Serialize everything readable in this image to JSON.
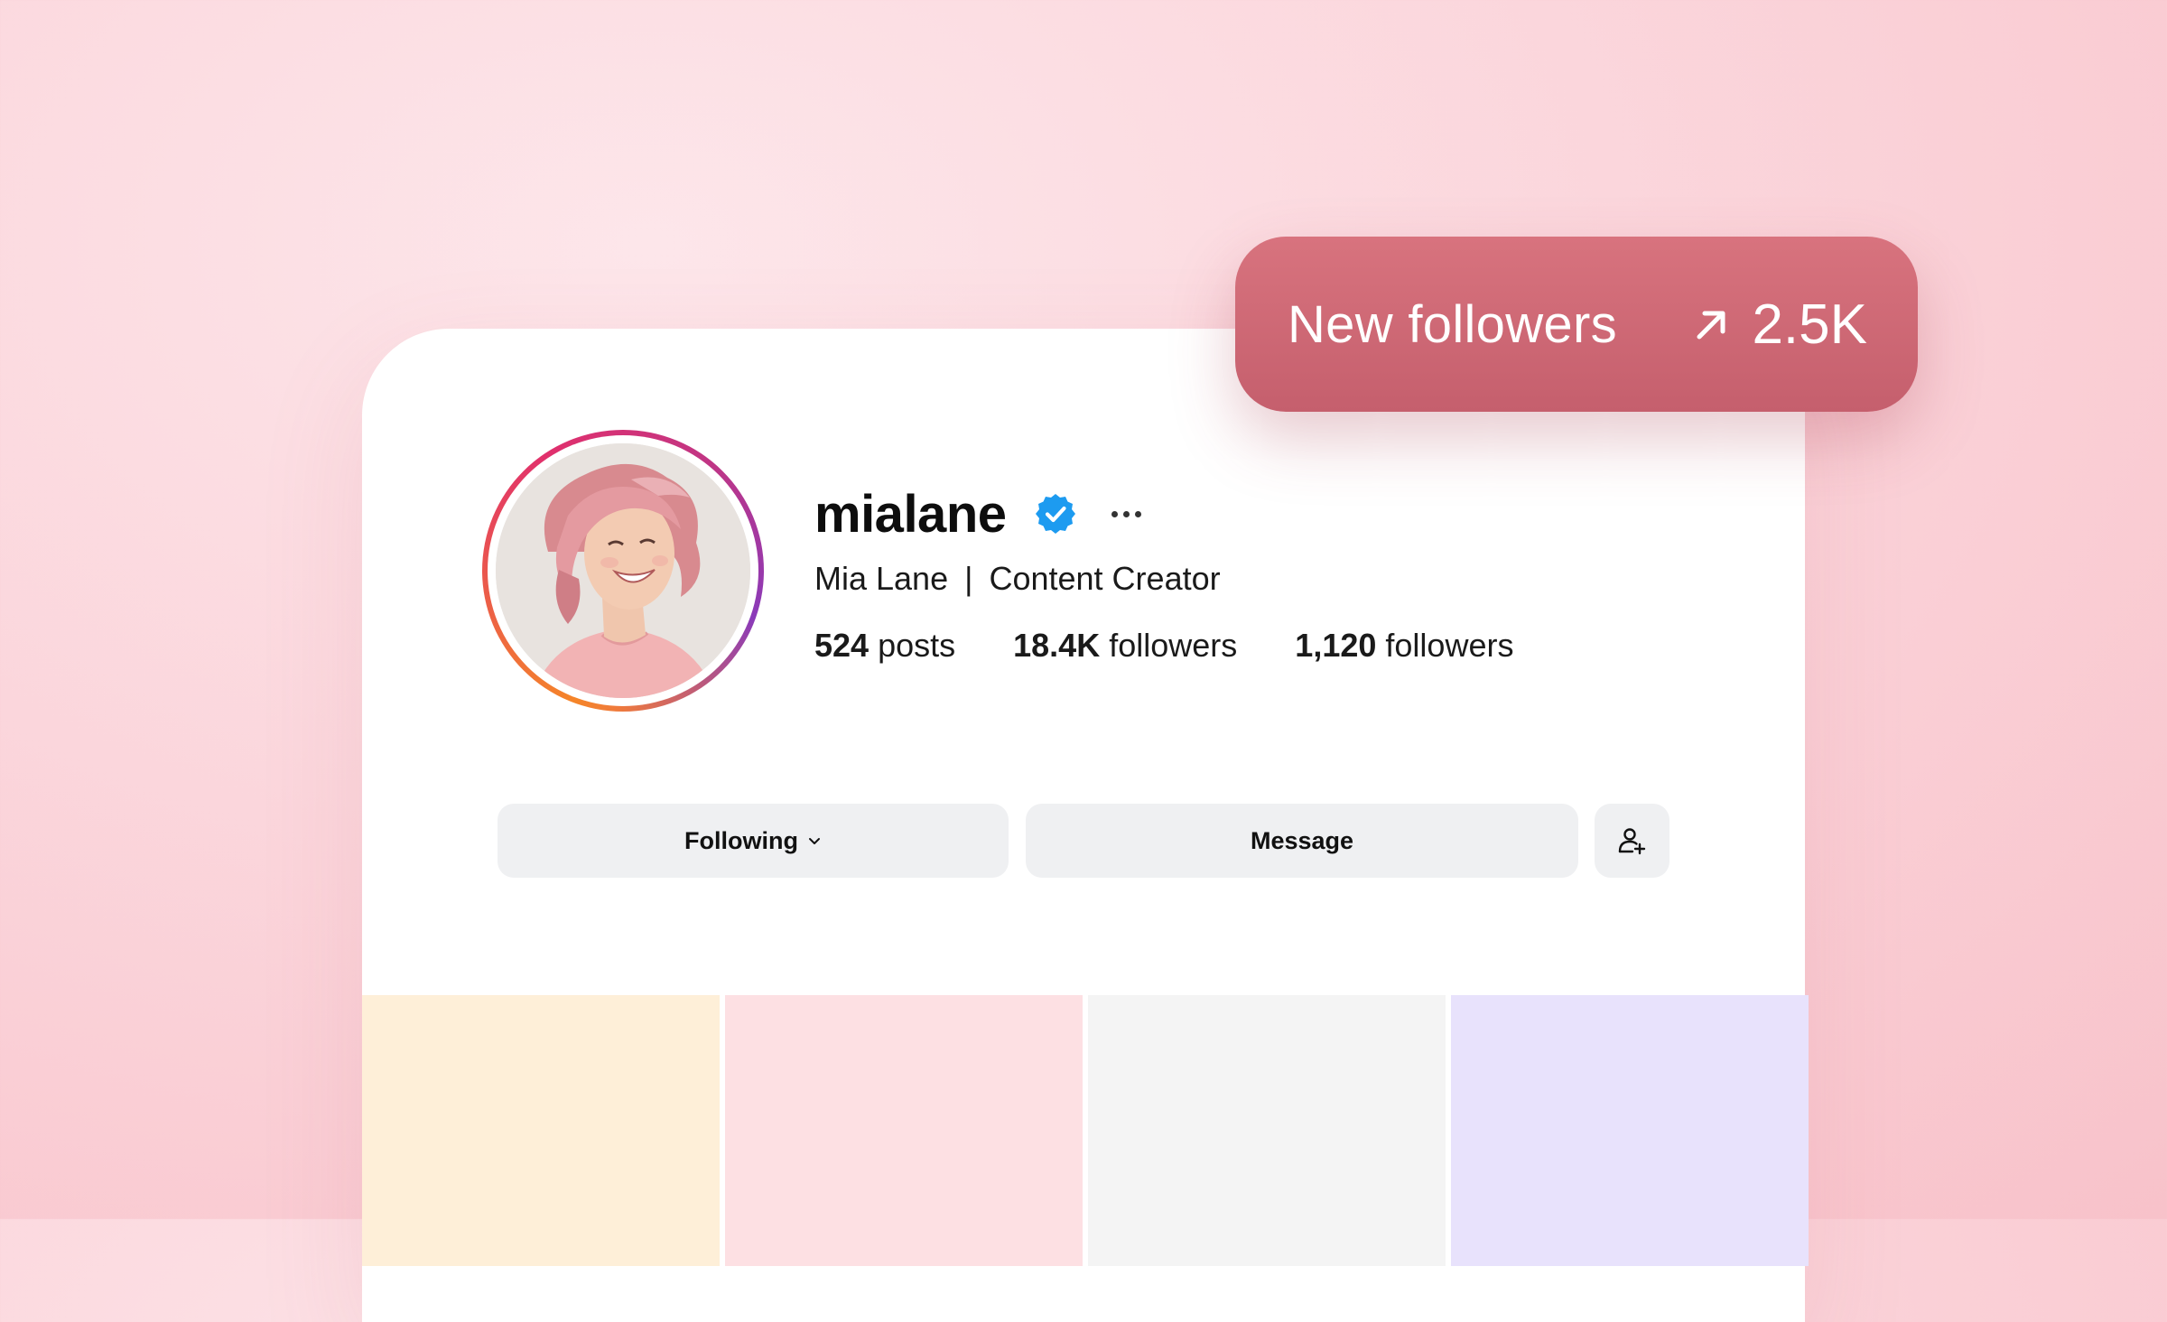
{
  "profile": {
    "username": "mialane",
    "verified": true,
    "display_name": "Mia Lane",
    "separator": "|",
    "bio_role": "Content Creator",
    "stats": [
      {
        "value": "524",
        "label": "posts"
      },
      {
        "value": "18.4K",
        "label": "followers"
      },
      {
        "value": "1,120",
        "label": "followers"
      }
    ]
  },
  "actions": {
    "following_label": "Following",
    "message_label": "Message"
  },
  "badge": {
    "label": "New followers",
    "value": "2.5K",
    "trend_icon": "arrow-up-right-icon"
  },
  "colors": {
    "badge_bg": "#c96470",
    "verified_blue": "#1d9bf0",
    "button_bg": "#eff0f2",
    "tiles": [
      "#feefd8",
      "#fde0e3",
      "#f4f4f4",
      "#e8e2fc"
    ]
  }
}
